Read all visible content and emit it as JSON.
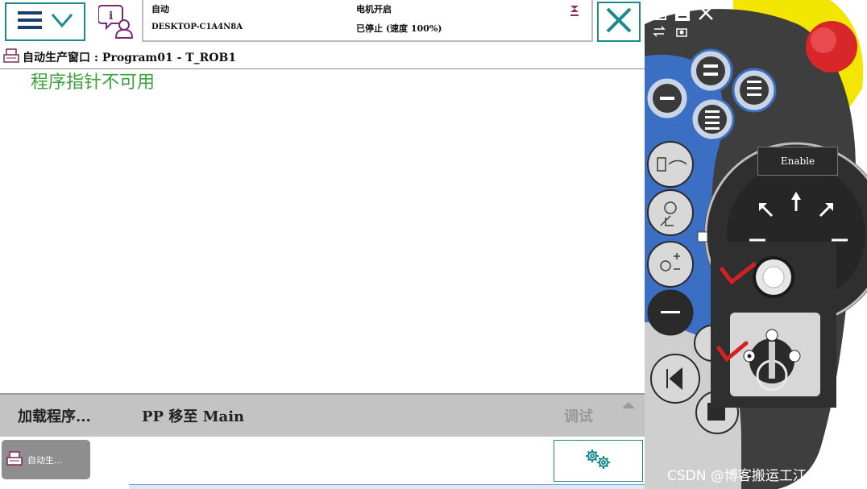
{
  "header": {
    "mode": "自动",
    "system_name": "DESKTOP-C1A4N8A",
    "motor_state": "电机开启",
    "run_state": "已停止 (速度 100%)"
  },
  "window": {
    "title": "自动生产窗口 : Program01 - T_ROB1",
    "message": "程序指针不可用"
  },
  "commands": {
    "load_program": "加载程序...",
    "pp_to_main": "PP 移至 Main",
    "debug": "调试"
  },
  "taskbar": {
    "task_label": "自动生..."
  },
  "pendant": {
    "enable_label": "Enable",
    "watermark": "CSDN @博客搬运工江上月"
  },
  "colors": {
    "accent": "#1b8a8a",
    "message": "#3ea13e",
    "command_bar": "#c3c3c3",
    "pendant_body": "#3e3e3e",
    "pendant_blue": "#3a6fc4",
    "emergency": "#d8262b",
    "yellow": "#f2e600",
    "check_mark": "#d42020"
  }
}
